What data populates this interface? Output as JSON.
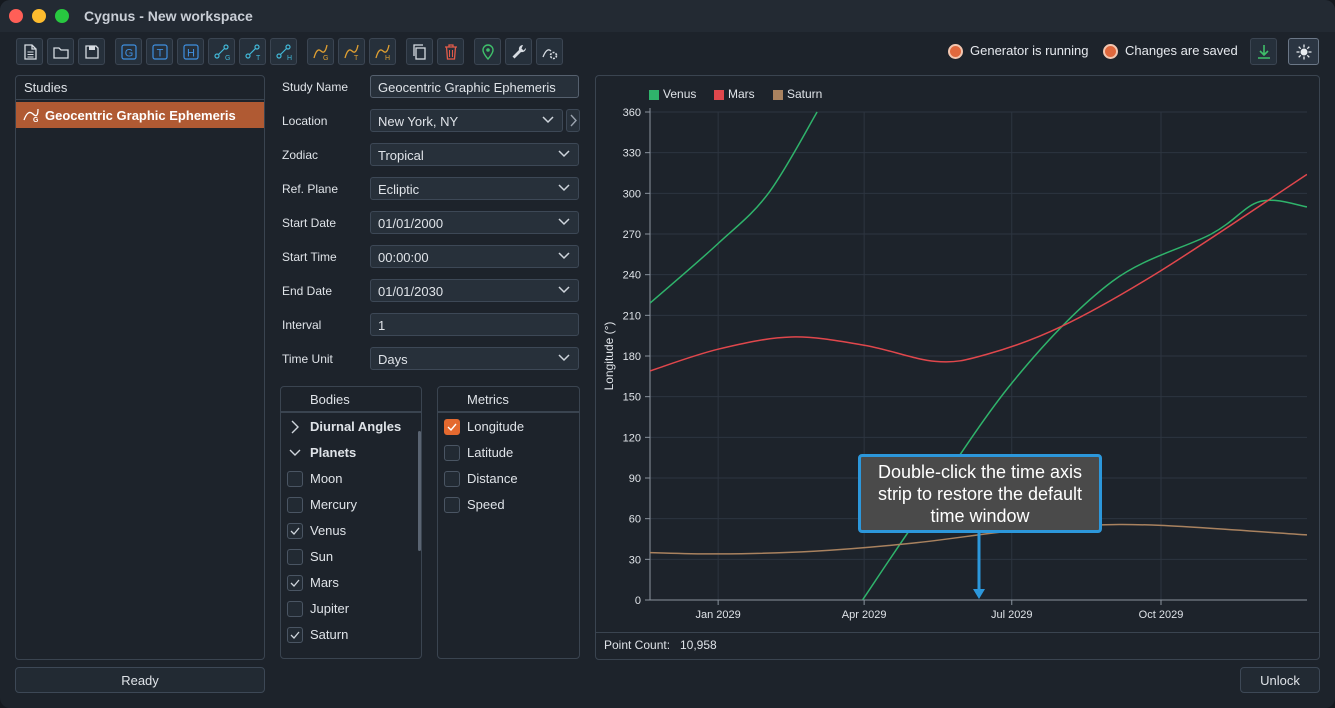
{
  "window": {
    "title": "Cygnus - New workspace"
  },
  "toolbar": {
    "buttons": [
      {
        "name": "new-file-icon",
        "glyph": "doc"
      },
      {
        "name": "open-folder-icon",
        "glyph": "folder"
      },
      {
        "name": "save-icon",
        "glyph": "save"
      },
      {
        "name": "g-icon",
        "glyph": "G"
      },
      {
        "name": "t-icon",
        "glyph": "T"
      },
      {
        "name": "h-icon",
        "glyph": "H"
      },
      {
        "name": "graph-g-icon",
        "glyph": "G"
      },
      {
        "name": "graph-t-icon",
        "glyph": "T"
      },
      {
        "name": "graph-h-icon",
        "glyph": "H"
      },
      {
        "name": "chart-g-icon",
        "glyph": "G"
      },
      {
        "name": "chart-t-icon",
        "glyph": "T"
      },
      {
        "name": "chart-h-icon",
        "glyph": "H"
      },
      {
        "name": "copy-icon",
        "glyph": "copy"
      },
      {
        "name": "trash-icon",
        "glyph": "trash"
      },
      {
        "name": "location-pin-icon",
        "glyph": "pin"
      },
      {
        "name": "wrench-icon",
        "glyph": "wrench"
      },
      {
        "name": "settings-chart-icon",
        "glyph": "gear"
      }
    ]
  },
  "status": {
    "generator": "Generator is running",
    "saved": "Changes are saved"
  },
  "studies": {
    "header": "Studies",
    "items": [
      {
        "label": "Geocentric Graphic Ephemeris"
      }
    ],
    "ready_label": "Ready"
  },
  "form": {
    "study_name_label": "Study Name",
    "study_name_value": "Geocentric Graphic Ephemeris",
    "location_label": "Location",
    "location_value": "New York, NY",
    "zodiac_label": "Zodiac",
    "zodiac_value": "Tropical",
    "ref_plane_label": "Ref. Plane",
    "ref_plane_value": "Ecliptic",
    "start_date_label": "Start Date",
    "start_date_value": "01/01/2000",
    "start_time_label": "Start Time",
    "start_time_value": "00:00:00",
    "end_date_label": "End Date",
    "end_date_value": "01/01/2030",
    "interval_label": "Interval",
    "interval_value": "1",
    "time_unit_label": "Time Unit",
    "time_unit_value": "Days"
  },
  "bodies": {
    "header": "Bodies",
    "items": [
      {
        "label": "Diurnal Angles",
        "kind": "group",
        "expanded": false
      },
      {
        "label": "Planets",
        "kind": "group",
        "expanded": true
      },
      {
        "label": "Moon",
        "checked": false
      },
      {
        "label": "Mercury",
        "checked": false
      },
      {
        "label": "Venus",
        "checked": true
      },
      {
        "label": "Sun",
        "checked": false
      },
      {
        "label": "Mars",
        "checked": true
      },
      {
        "label": "Jupiter",
        "checked": false
      },
      {
        "label": "Saturn",
        "checked": true
      }
    ]
  },
  "metrics": {
    "header": "Metrics",
    "items": [
      {
        "label": "Longitude",
        "checked": true
      },
      {
        "label": "Latitude",
        "checked": false
      },
      {
        "label": "Distance",
        "checked": false
      },
      {
        "label": "Speed",
        "checked": false
      }
    ]
  },
  "chart": {
    "point_count_label": "Point Count:",
    "point_count_value": "10,958",
    "callout": "Double-click the time axis strip to restore the default time window"
  },
  "chart_data": {
    "type": "line",
    "title": "",
    "xlabel": "",
    "ylabel": "Longitude (°)",
    "ylim": [
      0,
      360
    ],
    "yticks": [
      0,
      30,
      60,
      90,
      120,
      150,
      180,
      210,
      240,
      270,
      300,
      330,
      360
    ],
    "xlim": [
      "2028-11-20",
      "2029-12-30"
    ],
    "xticks": [
      {
        "label": "Jan 2029",
        "date": "2029-01-01"
      },
      {
        "label": "Apr 2029",
        "date": "2029-04-01"
      },
      {
        "label": "Jul 2029",
        "date": "2029-07-01"
      },
      {
        "label": "Oct 2029",
        "date": "2029-10-01"
      }
    ],
    "grid": true,
    "legend": "top-left",
    "series": [
      {
        "name": "Venus",
        "color": "#2fb36b",
        "segments": [
          [
            [
              "2028-11-20",
              219
            ],
            [
              "2029-01-01",
              263
            ],
            [
              "2029-02-01",
              300
            ],
            [
              "2029-03-03",
              360
            ]
          ],
          [
            [
              "2029-03-31",
              0
            ],
            [
              "2029-05-01",
              55
            ],
            [
              "2029-07-01",
              160
            ],
            [
              "2029-09-01",
              235
            ],
            [
              "2029-11-01",
              270
            ],
            [
              "2029-12-01",
              294
            ],
            [
              "2029-12-30",
              290
            ]
          ]
        ]
      },
      {
        "name": "Mars",
        "color": "#e0474c",
        "segments": [
          [
            [
              "2028-11-20",
              169
            ],
            [
              "2029-01-01",
              185
            ],
            [
              "2029-02-15",
              194
            ],
            [
              "2029-04-01",
              188
            ],
            [
              "2029-05-15",
              176
            ],
            [
              "2029-06-15",
              181
            ],
            [
              "2029-08-01",
              202
            ],
            [
              "2029-10-01",
              243
            ],
            [
              "2029-12-30",
              314
            ]
          ]
        ]
      },
      {
        "name": "Saturn",
        "color": "#a9825f",
        "segments": [
          [
            [
              "2028-11-20",
              35
            ],
            [
              "2029-01-01",
              34
            ],
            [
              "2029-03-01",
              36
            ],
            [
              "2029-05-01",
              42
            ],
            [
              "2029-07-01",
              51
            ],
            [
              "2029-08-15",
              55
            ],
            [
              "2029-10-01",
              55
            ],
            [
              "2029-12-30",
              48
            ]
          ]
        ]
      }
    ]
  },
  "colors": {
    "accent": "#b05a33",
    "callout_border": "#2c97db",
    "status_led": "#e0683d"
  }
}
